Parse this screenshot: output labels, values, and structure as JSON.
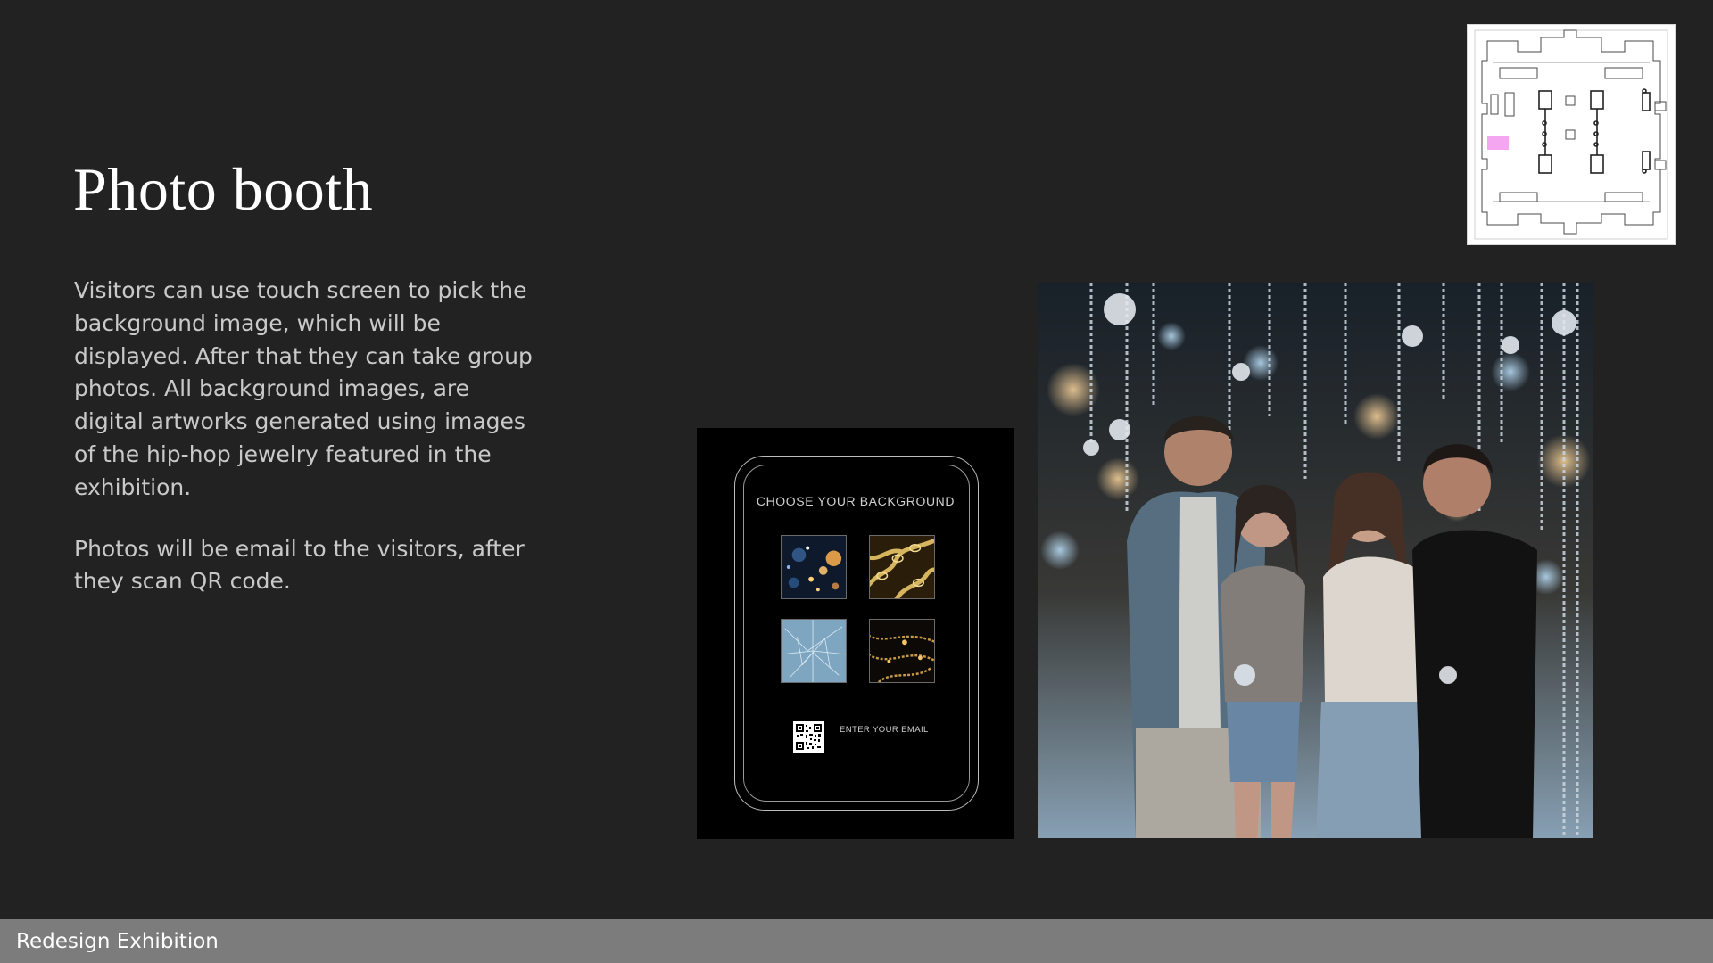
{
  "slide": {
    "title": "Photo booth",
    "description": [
      "Visitors can use touch screen to pick the background image, which will be displayed. After that they can take group photos. All background images, are digital artworks generated using images of the hip-hop  jewelry featured in the exhibition.",
      "Photos will be email to the visitors, after they scan QR code."
    ]
  },
  "floorplan": {
    "icon": "floorplan-thumbnail",
    "highlight_color": "#f4a6f0"
  },
  "tablet_mockup": {
    "heading": "CHOOSE YOUR BACKGROUND",
    "backgrounds": [
      {
        "name": "bokeh-lights"
      },
      {
        "name": "gold-chains"
      },
      {
        "name": "ice-crystal"
      },
      {
        "name": "gold-necklaces"
      }
    ],
    "qr_icon": "qr-code-icon",
    "email_label": "ENTER YOUR EMAIL"
  },
  "photo": {
    "subject": "group-photo-jewelry-installation"
  },
  "footer": {
    "label": "Redesign Exhibition"
  },
  "colors": {
    "background": "#222223",
    "footer": "#7c7c7c",
    "title": "#ffffff",
    "body_text": "#c9c9c9"
  }
}
